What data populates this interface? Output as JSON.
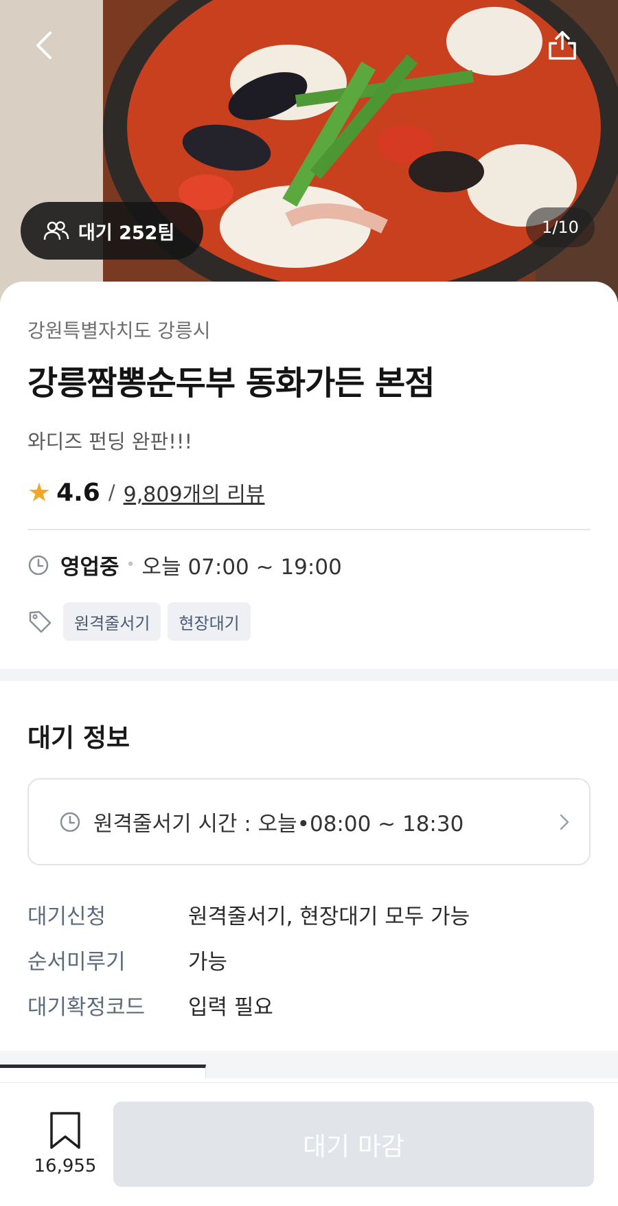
{
  "hero": {
    "wait_badge": "대기 252팀",
    "image_counter": "1/10"
  },
  "store": {
    "region": "강원특별자치도 강릉시",
    "name": "강릉짬뽕순두부 동화가든 본점",
    "slogan": "와디즈 펀딩 완판!!!",
    "rating": "4.6",
    "rating_separator": "/",
    "reviews": "9,809개의 리뷰",
    "status": "영업중",
    "hours": "오늘 07:00 ~ 19:00",
    "tags": [
      "원격줄서기",
      "현장대기"
    ]
  },
  "wait_info": {
    "title": "대기 정보",
    "remote_time": "원격줄서기 시간 : 오늘•08:00 ~ 18:30",
    "details": [
      {
        "label": "대기신청",
        "value": "원격줄서기, 현장대기 모두 가능"
      },
      {
        "label": "순서미루기",
        "value": "가능"
      },
      {
        "label": "대기확정코드",
        "value": "입력 필요"
      }
    ]
  },
  "bottom_bar": {
    "bookmark_count": "16,955",
    "cta_label": "대기 마감"
  },
  "colors": {
    "star": "#f4a62a",
    "tag_bg": "#eef0f4",
    "cta_disabled": "#e1e4e9"
  }
}
